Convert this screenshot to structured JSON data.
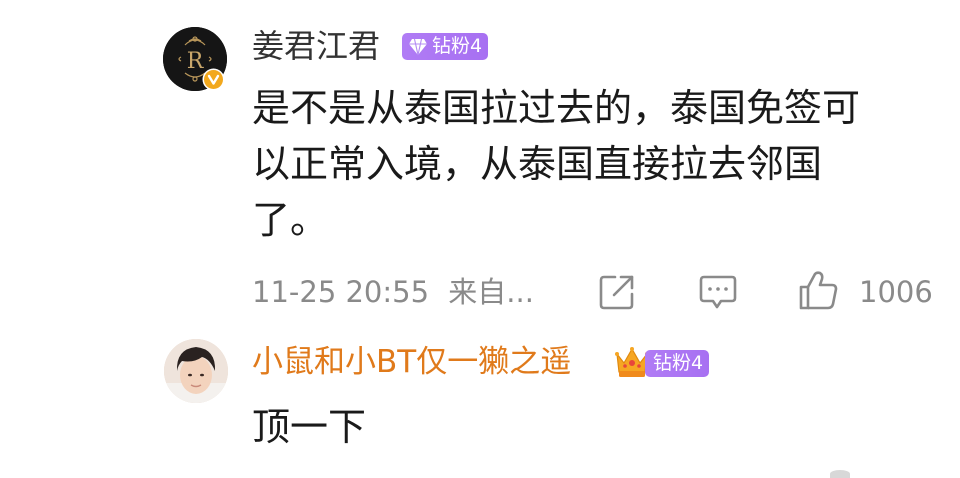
{
  "comments": [
    {
      "avatar_icon": "monogram-r-avatar-icon",
      "verified_icon": "verified-v-badge-icon",
      "verified_color": "#f2a81d",
      "username": "姜君江君",
      "fan_badge": {
        "icon": "diamond-icon",
        "label": "钻粉4",
        "color": "#a770f2"
      },
      "body_lines": [
        "是不是从泰国拉过去的，泰国免签可",
        "以正常入境，从泰国直接拉去邻国",
        "了。"
      ],
      "timestamp": "11-25 20:55",
      "source": "来自...",
      "actions": {
        "share_icon": "share-icon",
        "comment_icon": "comment-icon",
        "like_icon": "thumbs-up-icon",
        "like_count": "1006"
      }
    },
    {
      "avatar_icon": "user-photo-avatar-icon",
      "username": "小鼠和小BT仅一獭之遥",
      "username_color": "#e07a1b",
      "crown_icon": "crown-icon",
      "fan_badge": {
        "label": "钻粉4",
        "color": "#a770f2"
      },
      "body": "顶一下"
    }
  ]
}
